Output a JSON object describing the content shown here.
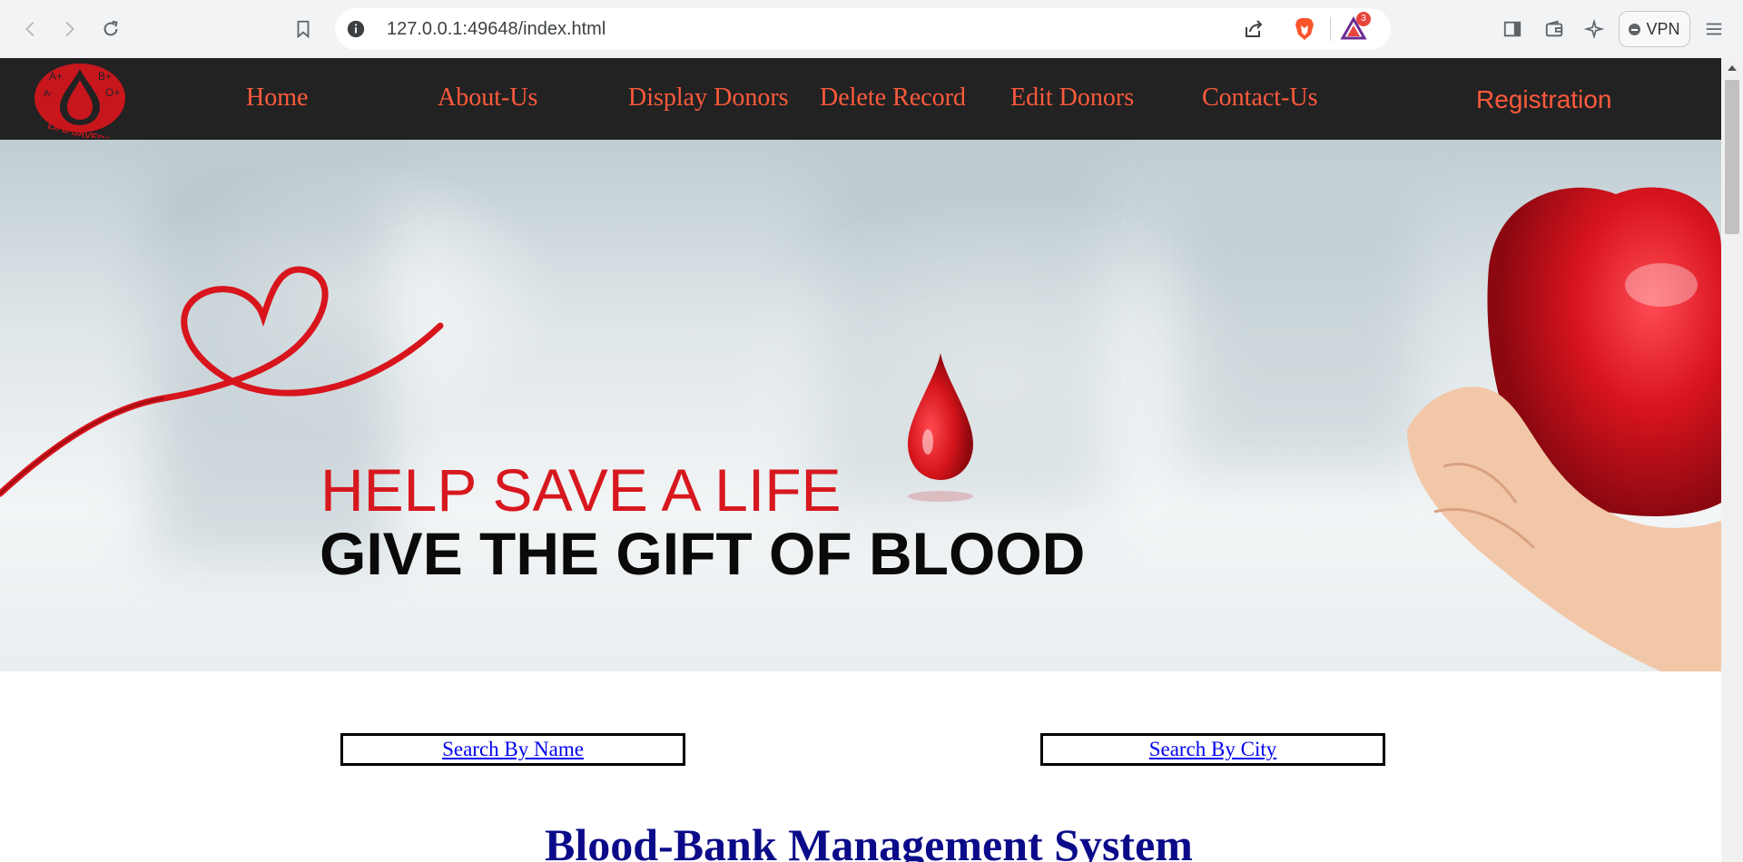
{
  "browser": {
    "url": "127.0.0.1:49648/index.html",
    "rewards_badge_count": "3",
    "vpn_label": "VPN"
  },
  "navbar": {
    "logo_text": "LIFE SAVERS",
    "links": [
      "Home",
      "About-Us",
      "Display Donors",
      "Delete Record",
      "Edit Donors",
      "Contact-Us"
    ],
    "registration_label": "Registration",
    "link_color": "#ff5a3c",
    "background": "#222222"
  },
  "hero": {
    "line1": "HELP SAVE A LIFE",
    "line2": "GIVE THE GIFT OF BLOOD",
    "accent_color": "#d7181f"
  },
  "search": {
    "by_name_label": "Search By Name",
    "by_city_label": "Search By City"
  },
  "main": {
    "title": "Blood-Bank Management System"
  },
  "icons": {
    "back": "arrow-left-icon",
    "forward": "arrow-right-icon",
    "reload": "reload-icon",
    "bookmark": "bookmark-icon",
    "info": "info-icon",
    "share": "share-icon",
    "brave": "brave-shield-icon",
    "rewards": "brave-rewards-icon",
    "sidebar": "sidebar-icon",
    "wallet": "wallet-icon",
    "leo": "leo-ai-icon",
    "menu": "hamburger-menu-icon"
  }
}
